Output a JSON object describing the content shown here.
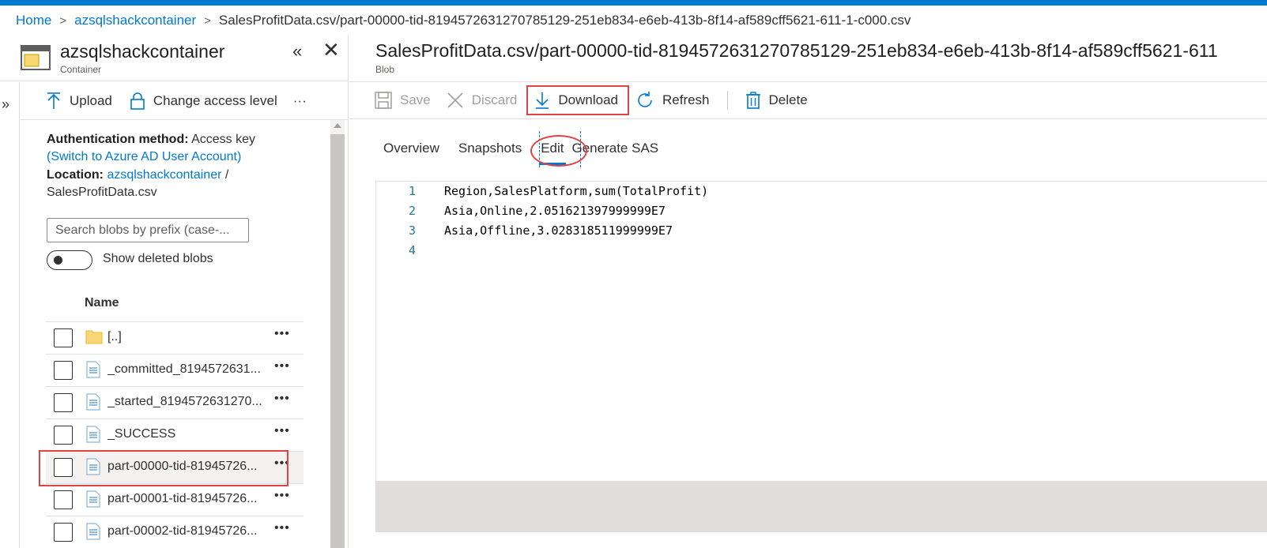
{
  "breadcrumb": {
    "home": "Home",
    "container": "azsqlshackcontainer",
    "current": "SalesProfitData.csv/part-00000-tid-8194572631270785129-251eb834-e6eb-413b-8f14-af589cff5621-611-1-c000.csv"
  },
  "left": {
    "title": "azsqlshackcontainer",
    "subtitle": "Container",
    "toolbar": {
      "upload": "Upload",
      "change_access": "Change access level",
      "more": "···"
    },
    "auth_label": "Authentication method:",
    "auth_value": "Access key",
    "switch_link": "(Switch to Azure AD User Account)",
    "location_label": "Location:",
    "location_link": "azsqlshackcontainer",
    "location_sep": "/",
    "location_path": "SalesProfitData.csv",
    "search_placeholder": "Search blobs by prefix (case-...",
    "show_deleted": "Show deleted blobs",
    "name_header": "Name",
    "rows": [
      {
        "name": "[..]",
        "type": "folder"
      },
      {
        "name": "_committed_8194572631...",
        "type": "file"
      },
      {
        "name": "_started_8194572631270...",
        "type": "file"
      },
      {
        "name": "_SUCCESS",
        "type": "file"
      },
      {
        "name": "part-00000-tid-81945726...",
        "type": "file",
        "selected": true
      },
      {
        "name": "part-00001-tid-81945726...",
        "type": "file"
      },
      {
        "name": "part-00002-tid-81945726...",
        "type": "file"
      }
    ],
    "row_more": "•••"
  },
  "right": {
    "title": "SalesProfitData.csv/part-00000-tid-8194572631270785129-251eb834-e6eb-413b-8f14-af589cff5621-611",
    "subtitle": "Blob",
    "toolbar": {
      "save": "Save",
      "discard": "Discard",
      "download": "Download",
      "refresh": "Refresh",
      "delete": "Delete"
    },
    "tabs": [
      "Overview",
      "Snapshots",
      "Edit",
      "Generate SAS"
    ],
    "active_tab": "Edit",
    "editor_lines": [
      {
        "no": "1",
        "text": "Region,SalesPlatform,sum(TotalProfit)"
      },
      {
        "no": "2",
        "text": "Asia,Online,2.051621397999999E7"
      },
      {
        "no": "3",
        "text": "Asia,Offline,3.028318511999999E7"
      },
      {
        "no": "4",
        "text": ""
      }
    ]
  },
  "colors": {
    "accent": "#0078d4",
    "highlight": "#e04343"
  }
}
